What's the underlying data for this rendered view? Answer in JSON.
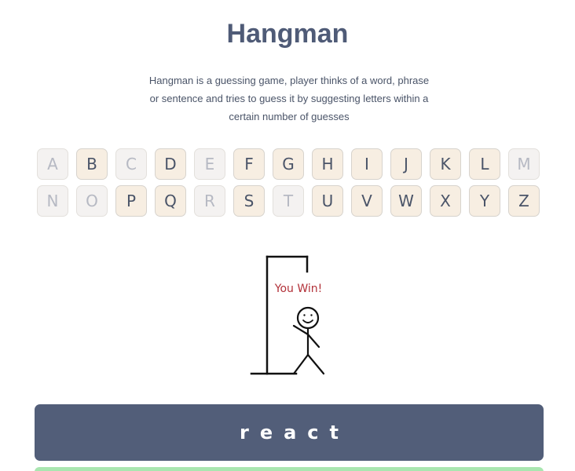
{
  "header": {
    "title": "Hangman"
  },
  "description": {
    "text": "Hangman is a guessing game, player thinks of a word, phrase or sentence and tries to guess it by suggesting letters within a certain number of guesses"
  },
  "keyboard": {
    "rows": [
      [
        {
          "letter": "A",
          "used": true
        },
        {
          "letter": "B",
          "used": false
        },
        {
          "letter": "C",
          "used": true
        },
        {
          "letter": "D",
          "used": false
        },
        {
          "letter": "E",
          "used": true
        },
        {
          "letter": "F",
          "used": false
        },
        {
          "letter": "G",
          "used": false
        },
        {
          "letter": "H",
          "used": false
        },
        {
          "letter": "I",
          "used": false
        },
        {
          "letter": "J",
          "used": false
        },
        {
          "letter": "K",
          "used": false
        },
        {
          "letter": "L",
          "used": false
        },
        {
          "letter": "M",
          "used": true
        }
      ],
      [
        {
          "letter": "N",
          "used": true
        },
        {
          "letter": "O",
          "used": true
        },
        {
          "letter": "P",
          "used": false
        },
        {
          "letter": "Q",
          "used": false
        },
        {
          "letter": "R",
          "used": true
        },
        {
          "letter": "S",
          "used": false
        },
        {
          "letter": "T",
          "used": true
        },
        {
          "letter": "U",
          "used": false
        },
        {
          "letter": "V",
          "used": false
        },
        {
          "letter": "W",
          "used": false
        },
        {
          "letter": "X",
          "used": false
        },
        {
          "letter": "Y",
          "used": false
        },
        {
          "letter": "Z",
          "used": false
        }
      ]
    ]
  },
  "status": {
    "message": "You Win!"
  },
  "word": {
    "display": "react"
  },
  "colors": {
    "title": "#4f5b77",
    "key_available": "#f7eee2",
    "key_used": "#f4f2f1",
    "win_text": "#b23139",
    "word_bar": "#525e79",
    "bottom_bar": "#a9e6b0"
  }
}
